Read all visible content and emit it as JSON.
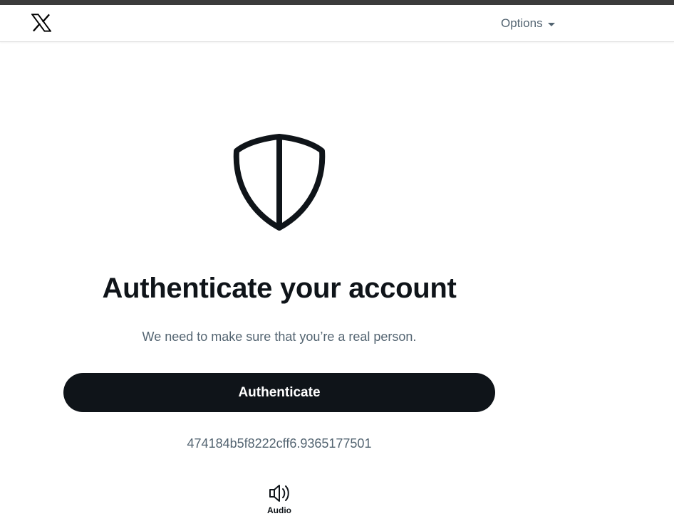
{
  "header": {
    "logo_icon": "x-logo-icon",
    "options_label": "Options"
  },
  "main": {
    "icon": "shield-icon",
    "title": "Authenticate your account",
    "subtitle": "We need to make sure that you’re a real person.",
    "button_label": "Authenticate",
    "session_id": "474184b5f8222cff6.9365177501",
    "audio_label": "Audio",
    "audio_icon": "speaker-icon"
  },
  "colors": {
    "button_bg": "#0f1419",
    "text_primary": "#0f1419",
    "text_secondary": "#536471"
  }
}
